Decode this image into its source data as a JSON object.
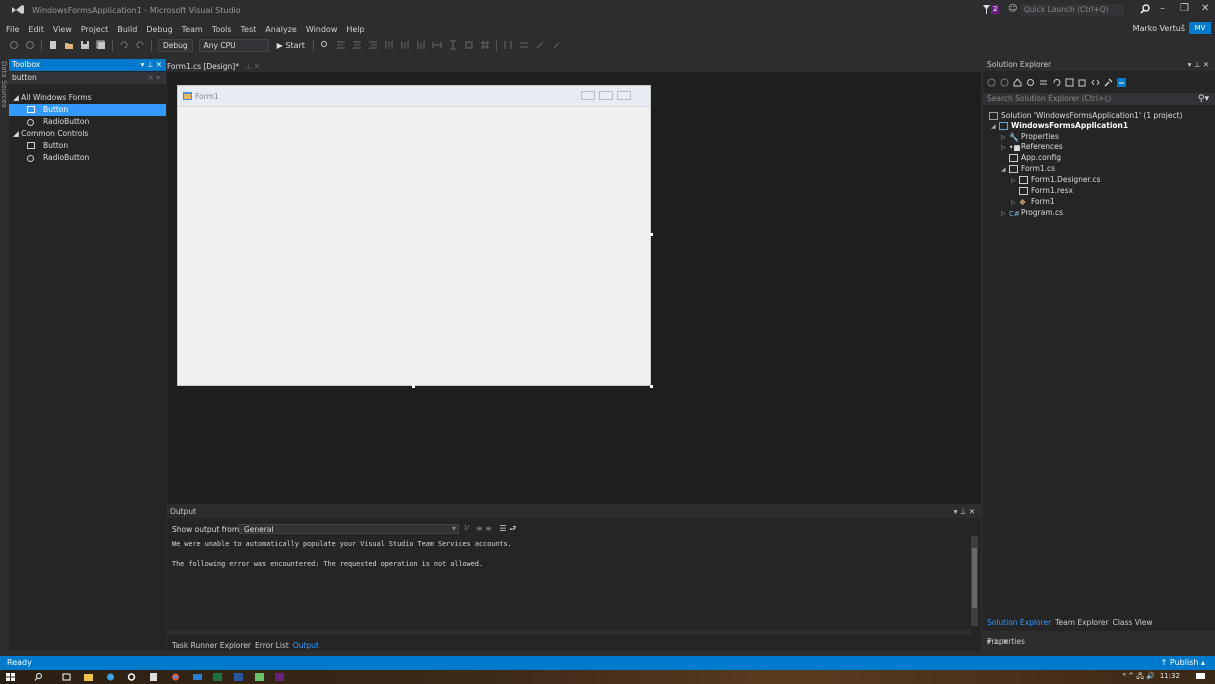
{
  "window": {
    "title": "WindowsFormsApplication1 - Microsoft Visual Studio",
    "notification_count": "2",
    "quick_launch_placeholder": "Quick Launch (Ctrl+Q)",
    "minimize": "–",
    "restore": "❐",
    "close": "✕"
  },
  "menu": [
    "File",
    "Edit",
    "View",
    "Project",
    "Build",
    "Debug",
    "Team",
    "Tools",
    "Test",
    "Analyze",
    "Window",
    "Help"
  ],
  "user": {
    "name": "Marko Vertuš",
    "initials": "MV"
  },
  "toolbar": {
    "config": "Debug",
    "platform": "Any CPU",
    "start_label": "▶ Start"
  },
  "data_sources_label": "Data Sources",
  "toolbox": {
    "title": "Toolbox",
    "search_value": "button",
    "groups": [
      {
        "label": "◢ All Windows Forms",
        "items": [
          "Button",
          "RadioButton"
        ]
      },
      {
        "label": "◢ Common Controls",
        "items": [
          "Button",
          "RadioButton"
        ]
      }
    ]
  },
  "document": {
    "tab_label": "Form1.cs [Design]*",
    "form_title": "Form1"
  },
  "output": {
    "title": "Output",
    "show_from_label": "Show output from:",
    "source": "General",
    "lines": [
      "We were unable to automatically populate your Visual Studio Team Services accounts.",
      "The following error was encountered: The requested operation is not allowed."
    ],
    "tabs": [
      "Task Runner Explorer",
      "Error List",
      "Output"
    ],
    "active_tab": "Output"
  },
  "solution_explorer": {
    "title": "Solution Explorer",
    "search_placeholder": "Search Solution Explorer (Ctrl+ç)",
    "solution": "Solution 'WindowsFormsApplication1' (1 project)",
    "project": "WindowsFormsApplication1",
    "nodes": {
      "properties": "Properties",
      "references": "References",
      "app_config": "App.config",
      "form1_cs": "Form1.cs",
      "form1_designer": "Form1.Designer.cs",
      "form1_resx": "Form1.resx",
      "form1": "Form1",
      "program": "Program.cs"
    },
    "tabs": [
      "Solution Explorer",
      "Team Explorer",
      "Class View"
    ],
    "active_tab": "Solution Explorer"
  },
  "properties": {
    "title": "Properties"
  },
  "status": {
    "text": "Ready",
    "publish": "↑ Publish ▴"
  },
  "taskbar": {
    "time": "11:32"
  },
  "colors": {
    "accent": "#007acc",
    "selection": "#3399ff",
    "background": "#2d2d30",
    "editor": "#1e1e1e"
  }
}
